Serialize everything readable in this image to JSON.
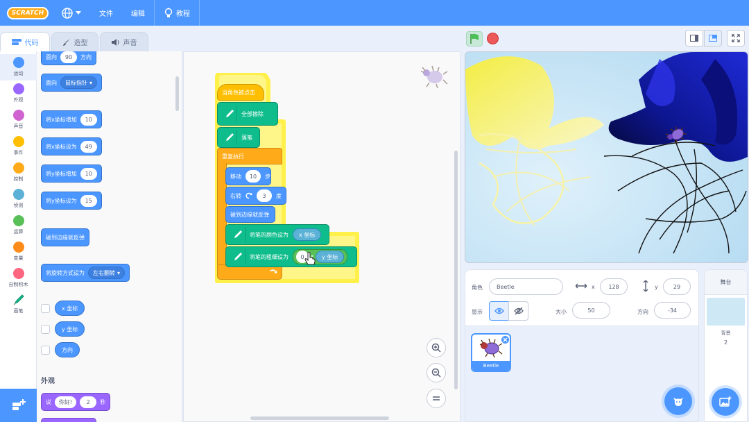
{
  "menubar": {
    "logo": "SCRATCH",
    "file": "文件",
    "edit": "编辑",
    "tutorials": "教程"
  },
  "tabs": {
    "code": "代码",
    "costumes": "造型",
    "sounds": "声音"
  },
  "categories": [
    {
      "label": "运动",
      "color": "#4c97ff"
    },
    {
      "label": "外观",
      "color": "#9966ff"
    },
    {
      "label": "声音",
      "color": "#cf63cf"
    },
    {
      "label": "事件",
      "color": "#ffbf00"
    },
    {
      "label": "控制",
      "color": "#ffab19"
    },
    {
      "label": "侦测",
      "color": "#5cb1d6"
    },
    {
      "label": "运算",
      "color": "#59c059"
    },
    {
      "label": "变量",
      "color": "#ff8c1a"
    },
    {
      "label": "自制积木",
      "color": "#ff6680"
    },
    {
      "label": "画笔",
      "color": "#0fbd8c"
    }
  ],
  "palette": {
    "point_dir": {
      "text1": "面向",
      "value": "90",
      "text2": "方向"
    },
    "point_towards": {
      "text": "面向",
      "dropdown": "鼠标指针"
    },
    "change_x": {
      "text": "将x坐标增加",
      "value": "10"
    },
    "set_x": {
      "text": "将x坐标设为",
      "value": "49"
    },
    "change_y": {
      "text": "将y坐标增加",
      "value": "10"
    },
    "set_y": {
      "text": "将y坐标设为",
      "value": "15"
    },
    "bounce": {
      "text": "碰到边缘就反弹"
    },
    "rotation_style": {
      "text": "将旋转方式设为",
      "dropdown": "左右翻转"
    },
    "reporters": [
      "x 坐标",
      "y 坐标",
      "方向"
    ],
    "looks_heading": "外观",
    "say": {
      "text1": "说",
      "value1": "你好!",
      "value2": "2",
      "text2": "秒"
    }
  },
  "script": {
    "hat": "当角色被点击",
    "clear": "全部擦除",
    "pen_down": "落笔",
    "forever": "重复执行",
    "move": {
      "text1": "移动",
      "value": "10",
      "text2": "步"
    },
    "turn": {
      "text1": "右转",
      "value": "3",
      "text2": "度"
    },
    "bounce": "碰到边缘就反弹",
    "set_color": {
      "text": "将笔的颜色设为",
      "reporter": "x 坐标"
    },
    "set_size": {
      "text": "将笔的粗细设为",
      "value": "0",
      "op": "*",
      "reporter": "y 坐标"
    }
  },
  "sprite_info": {
    "sprite_label": "角色",
    "sprite_name": "Beetle",
    "x_label": "x",
    "x": "128",
    "y_label": "y",
    "y": "29",
    "show_label": "显示",
    "size_label": "大小",
    "size": "50",
    "direction_label": "方向",
    "direction": "-34"
  },
  "sprite_list": [
    {
      "name": "Beetle"
    }
  ],
  "stage_panel": {
    "title": "舞台",
    "backdrop_label": "背景",
    "backdrop_count": "2"
  },
  "colors": {
    "accent": "#4c97ff",
    "events": "#ffbf00",
    "control": "#ffab19",
    "pen": "#0fbd8c",
    "sensing": "#5cb1d6"
  }
}
